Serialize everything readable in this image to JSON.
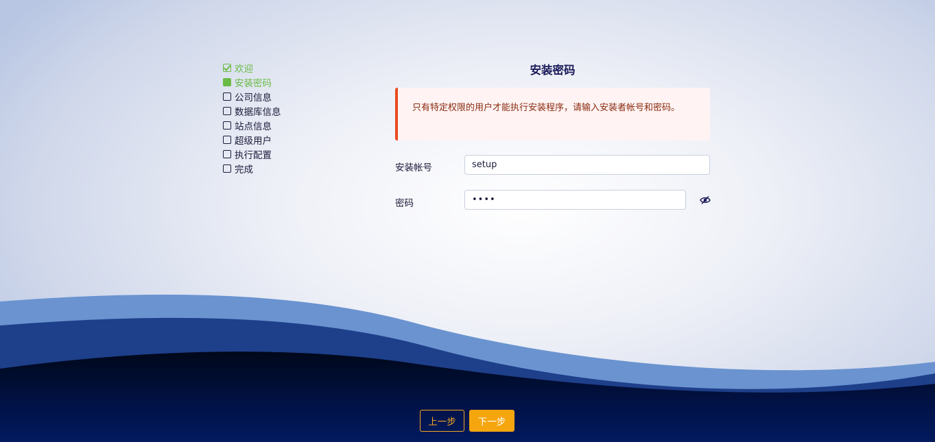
{
  "steps": [
    {
      "label": "欢迎",
      "state": "done"
    },
    {
      "label": "安装密码",
      "state": "active"
    },
    {
      "label": "公司信息",
      "state": "pending"
    },
    {
      "label": "数据库信息",
      "state": "pending"
    },
    {
      "label": "站点信息",
      "state": "pending"
    },
    {
      "label": "超级用户",
      "state": "pending"
    },
    {
      "label": "执行配置",
      "state": "pending"
    },
    {
      "label": "完成",
      "state": "pending"
    }
  ],
  "form": {
    "title": "安装密码",
    "alert": "只有特定权限的用户才能执行安装程序，请输入安装者帐号和密码。",
    "account_label": "安装帐号",
    "account_value": "setup",
    "password_label": "密码",
    "password_value": "••••"
  },
  "buttons": {
    "prev": "上一步",
    "next": "下一步"
  },
  "colors": {
    "accent_green": "#6abb45",
    "accent_orange": "#f5a60f",
    "alert_border": "#e84a1d",
    "title": "#1b1b5a"
  },
  "icons": {
    "step_done": "check-square-icon",
    "step_active": "filled-square-icon",
    "step_pending": "empty-square-icon",
    "password_toggle": "eye-slash-icon"
  }
}
